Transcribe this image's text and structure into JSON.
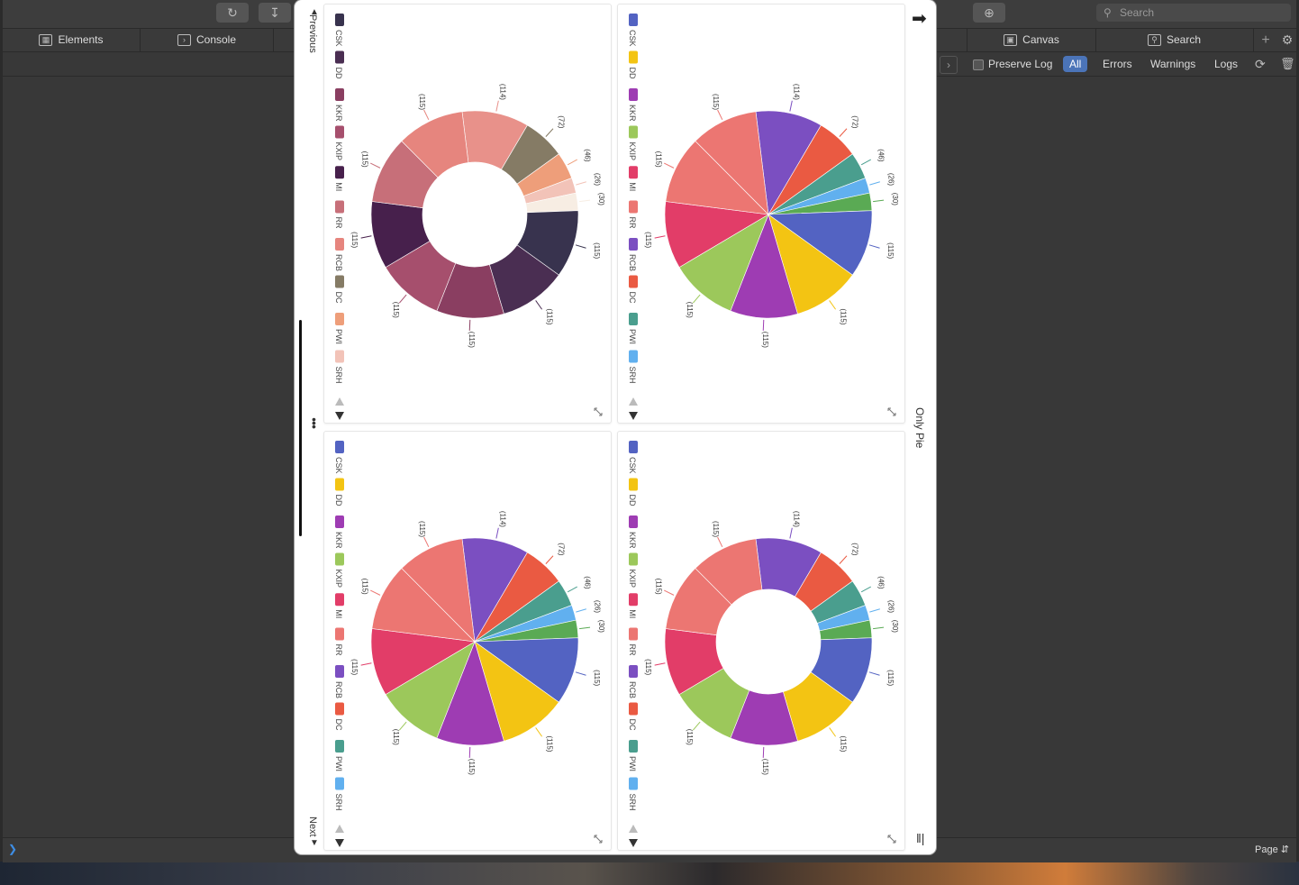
{
  "devtools": {
    "toolbar": {
      "reload_icon": "reload-icon",
      "download_icon": "download-icon",
      "target_icon": "crosshair-icon",
      "search_placeholder": "Search"
    },
    "tabs": [
      {
        "label": "Elements",
        "icon": "elements-icon"
      },
      {
        "label": "Console",
        "icon": "console-icon"
      },
      {
        "label": "Canvas",
        "icon": "canvas-icon"
      },
      {
        "label": "Search",
        "icon": "search-icon"
      }
    ],
    "filters": {
      "preserve_log": "Preserve Log",
      "all": "All",
      "errors": "Errors",
      "warnings": "Warnings",
      "logs": "Logs"
    },
    "bottom": {
      "page_selector": "Page"
    }
  },
  "modal": {
    "previous_label": "Previous",
    "next_label": "Next",
    "side_title": "Only Pie"
  },
  "chart_data": [
    {
      "type": "pie",
      "variant": "donut",
      "palette": "plum",
      "categories": [
        "CSK",
        "DD",
        "KKR",
        "KXIP",
        "MI",
        "RR",
        "RCB",
        "DC",
        "PWI",
        "SRH"
      ],
      "labels": [
        "(114)",
        "(72)",
        "(46)",
        "(26)",
        "(30)",
        "(115)",
        "(115)",
        "(115)",
        "(115)",
        "(115)",
        "(115)",
        "(115)"
      ],
      "values": [
        114,
        72,
        46,
        26,
        30,
        115,
        115,
        115,
        115,
        115,
        115,
        115
      ],
      "colors": [
        "#e8918a",
        "#857b65",
        "#ee9e7a",
        "#f2c3b8",
        "#f7ede3",
        "#38334e",
        "#4a2e52",
        "#8a3e61",
        "#a64f6d",
        "#47204c",
        "#c76f79",
        "#e6857e"
      ],
      "legend_colors": [
        "#38334e",
        "#4a2e52",
        "#8a3e61",
        "#a64f6d",
        "#47204c",
        "#c76f79",
        "#e6857e",
        "#857b65",
        "#ee9e7a",
        "#f2c3b8"
      ],
      "legend": "left, rotated"
    },
    {
      "type": "pie",
      "variant": "pie",
      "palette": "bright",
      "categories": [
        "CSK",
        "DD",
        "KKR",
        "KXIP",
        "MI",
        "RR",
        "RCB",
        "DC",
        "PWI",
        "SRH"
      ],
      "labels": [
        "(114)",
        "(72)",
        "(46)",
        "(26)",
        "(30)",
        "(115)",
        "(115)",
        "(115)",
        "(115)",
        "(115)",
        "(115)",
        "(115)"
      ],
      "values": [
        114,
        72,
        46,
        26,
        30,
        115,
        115,
        115,
        115,
        115,
        115,
        115
      ],
      "colors": [
        "#7b4fc1",
        "#ea5a42",
        "#4a9e8e",
        "#61b0ef",
        "#5aaa54",
        "#5363c2",
        "#f3c413",
        "#9e3cb3",
        "#9cc85b",
        "#e23d68",
        "#ec7672",
        "#ec7672"
      ],
      "legend_colors": [
        "#5363c2",
        "#f3c413",
        "#9e3cb3",
        "#9cc85b",
        "#e23d68",
        "#ec7672",
        "#7b4fc1",
        "#ea5a42",
        "#4a9e8e",
        "#61b0ef"
      ],
      "legend": "left, rotated"
    },
    {
      "type": "pie",
      "variant": "pie",
      "palette": "bright",
      "categories": [
        "CSK",
        "DD",
        "KKR",
        "KXIP",
        "MI",
        "RR",
        "RCB",
        "DC",
        "PWI",
        "SRH"
      ],
      "labels": [
        "(114)",
        "(72)",
        "(46)",
        "(26)",
        "(30)",
        "(115)",
        "(115)",
        "(115)",
        "(115)",
        "(115)",
        "(115)",
        "(115)"
      ],
      "values": [
        114,
        72,
        46,
        26,
        30,
        115,
        115,
        115,
        115,
        115,
        115,
        115
      ],
      "colors": [
        "#7b4fc1",
        "#ea5a42",
        "#4a9e8e",
        "#61b0ef",
        "#5aaa54",
        "#5363c2",
        "#f3c413",
        "#9e3cb3",
        "#9cc85b",
        "#e23d68",
        "#ec7672",
        "#ec7672"
      ],
      "legend_colors": [
        "#5363c2",
        "#f3c413",
        "#9e3cb3",
        "#9cc85b",
        "#e23d68",
        "#ec7672",
        "#7b4fc1",
        "#ea5a42",
        "#4a9e8e",
        "#61b0ef"
      ],
      "legend": "left, rotated"
    },
    {
      "type": "pie",
      "variant": "donut",
      "palette": "bright",
      "categories": [
        "CSK",
        "DD",
        "KKR",
        "KXIP",
        "MI",
        "RR",
        "RCB",
        "DC",
        "PWI",
        "SRH"
      ],
      "labels": [
        "(114)",
        "(72)",
        "(46)",
        "(26)",
        "(30)",
        "(115)",
        "(115)",
        "(115)",
        "(115)",
        "(115)",
        "(115)",
        "(115)"
      ],
      "values": [
        114,
        72,
        46,
        26,
        30,
        115,
        115,
        115,
        115,
        115,
        115,
        115
      ],
      "colors": [
        "#7b4fc1",
        "#ea5a42",
        "#4a9e8e",
        "#61b0ef",
        "#5aaa54",
        "#5363c2",
        "#f3c413",
        "#9e3cb3",
        "#9cc85b",
        "#e23d68",
        "#ec7672",
        "#ec7672"
      ],
      "legend_colors": [
        "#5363c2",
        "#f3c413",
        "#9e3cb3",
        "#9cc85b",
        "#e23d68",
        "#ec7672",
        "#7b4fc1",
        "#ea5a42",
        "#4a9e8e",
        "#61b0ef"
      ],
      "legend": "left, rotated"
    }
  ]
}
